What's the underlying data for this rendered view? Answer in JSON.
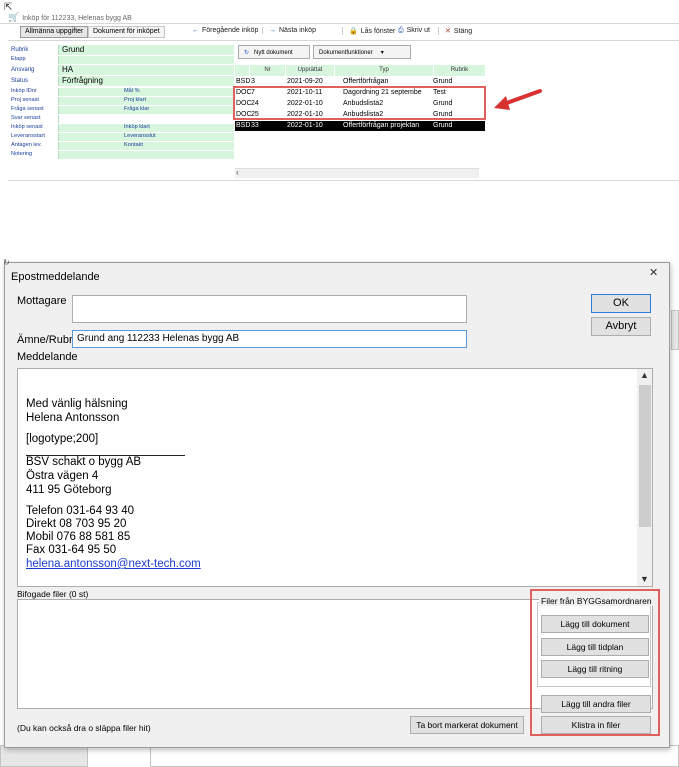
{
  "top_window": {
    "title": "Inköp för 112233, Helenas bygg AB",
    "tabs": [
      "Allmänna uppgifter",
      "Dokument för inköpet"
    ],
    "toolbar": {
      "prev": "Föregående inköp",
      "next": "Nästa inköp",
      "lock": "Lås fönster",
      "print": "Skriv ut",
      "close": "Stäng"
    },
    "fields": [
      {
        "label": "Rubrik",
        "value": "Grund"
      },
      {
        "label": "Etapp",
        "value": ""
      },
      {
        "label": "Ansvarig",
        "value": "HA"
      },
      {
        "label": "Status",
        "value": "Förfrågning"
      }
    ],
    "pair_fields": [
      {
        "left": "Inköp IDnr",
        "right": "Mål %"
      },
      {
        "left": "Proj senast",
        "right": "Proj klart"
      },
      {
        "left": "Fråga senast",
        "right": "Fråga klar"
      },
      {
        "left": "Svar senast",
        "right": ""
      },
      {
        "left": "Inköp senast",
        "right": "Inköp klart"
      },
      {
        "left": "Leveransstart",
        "right": "Leveransslut"
      },
      {
        "left": "Antagen lev.",
        "right": "Kontakt"
      },
      {
        "left": "Notering",
        "right": ""
      }
    ],
    "doc_buttons": {
      "new": "Nytt dokument",
      "functions": "Dokumentfunktioner"
    },
    "doc_columns": [
      "Nr",
      "Upprättat",
      "Typ",
      "Rubrik"
    ],
    "doc_rows": [
      {
        "kind": "BSD",
        "nr": "3",
        "date": "2021-09-20",
        "type": "Offertförfrågan",
        "title": "Grund",
        "selected": false
      },
      {
        "kind": "DOC",
        "nr": "7",
        "date": "2021-10-11",
        "type": "Dagordning  21 septembe",
        "title": "Test",
        "selected": false
      },
      {
        "kind": "DOC",
        "nr": "24",
        "date": "2022-01-10",
        "type": "Anbudslista2",
        "title": "Grund",
        "selected": false
      },
      {
        "kind": "DOC",
        "nr": "25",
        "date": "2022-01-10",
        "type": "Anbudslista2",
        "title": "Grund",
        "selected": false
      },
      {
        "kind": "BSD",
        "nr": "33",
        "date": "2022-01-10",
        "type": "Offertförfrågan projektan",
        "title": "Grund",
        "selected": true
      }
    ],
    "highlight_color": "#e06060",
    "arrow_color": "#d93030"
  },
  "dialog": {
    "title": "Epostmeddelande",
    "recipient_label": "Mottagare",
    "recipient_value": "",
    "subject_label": "Ämne/Rubrik",
    "subject_value": "Grund ang 112233 Helenas bygg AB",
    "message_label": "Meddelande",
    "message_lines": [
      "Med vänlig hälsning",
      "Helena Antonsson",
      "[logotype;200]",
      "BSV schakt o bygg AB",
      "Östra vägen 4",
      "411 95 Göteborg",
      "Telefon 031-64 93 40",
      "Direkt 08 703 95 20",
      "Mobil 076 88 581 85",
      "Fax 031-64 95 50"
    ],
    "message_email": "helena.antonsson@next-tech.com",
    "attachments_label": "Bifogade filer (0 st)",
    "drag_hint": "(Du kan också dra o släppa filer hit)",
    "buttons": {
      "ok": "OK",
      "cancel": "Avbryt",
      "remove_marked": "Ta bort markerat dokument",
      "group_title": "Filer från BYGGsamordnaren",
      "add_document": "Lägg till dokument",
      "add_timeplan": "Lägg till tidplan",
      "add_drawing": "Lägg till ritning",
      "add_other": "Lägg till andra filer",
      "paste_files": "Klistra in filer"
    }
  }
}
